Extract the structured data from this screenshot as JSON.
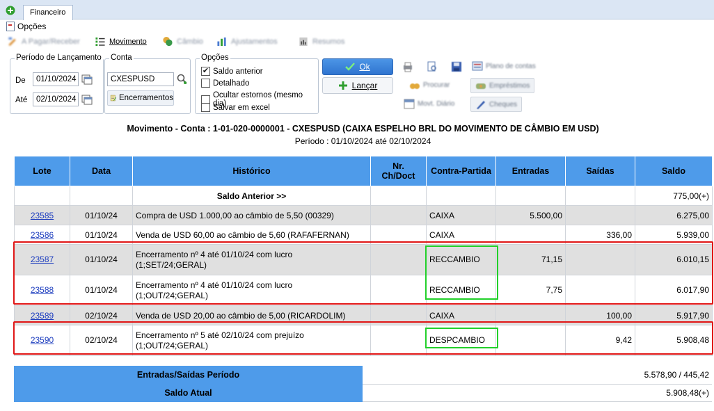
{
  "window": {
    "tab_label": "Financeiro",
    "menu_opcoes": "Opções"
  },
  "toolbar": {
    "pagar_receber": "A Pagar/Receber",
    "movimento": "Movimento",
    "cambio": "Câmbio",
    "ajustamentos": "Ajustamentos",
    "resumos": "Resumos"
  },
  "periodo": {
    "legend": "Período de Lançamento",
    "de_label": "De",
    "de_value": "01/10/2024",
    "ate_label": "Até",
    "ate_value": "02/10/2024"
  },
  "conta": {
    "legend": "Conta",
    "value": "CXESPUSD",
    "encerramentos_label": "Encerramentos"
  },
  "opcoes": {
    "legend": "Opções",
    "items": [
      {
        "label": "Saldo anterior",
        "checked": true
      },
      {
        "label": "Detalhado",
        "checked": false
      },
      {
        "label": "Ocultar estornos (mesmo dia)",
        "checked": false
      },
      {
        "label": "Salvar em excel",
        "checked": false
      }
    ]
  },
  "actions": {
    "ok_label": "Ok",
    "lancar_label": "Lançar",
    "plano_contas": "Plano de contas",
    "procurar": "Procurar",
    "emprestimos": "Empréstimos",
    "movt_diario": "Movt. Diário",
    "cheques": "Cheques"
  },
  "report": {
    "title": "Movimento - Conta : 1-01-020-0000001 - CXESPUSD (CAIXA ESPELHO BRL DO MOVIMENTO DE CÂMBIO EM USD)",
    "period": "Período : 01/10/2024 até 02/10/2024"
  },
  "table": {
    "headers": {
      "lote": "Lote",
      "data": "Data",
      "historico": "Histórico",
      "nr_line1": "Nr.",
      "nr_line2": "Ch/Doct",
      "contra": "Contra-Partida",
      "entradas": "Entradas",
      "saidas": "Saídas",
      "saldo": "Saldo"
    },
    "saldo_anterior": {
      "label": "Saldo Anterior >>",
      "saldo": "775,00(+)"
    },
    "rows": [
      {
        "lote": "23585",
        "data": "01/10/24",
        "hist1": "Compra de USD 1.000,00 ao câmbio de 5,50 (00329)",
        "hist2": "",
        "contra": "CAIXA",
        "entradas": "5.500,00",
        "saidas": "",
        "saldo": "6.275,00"
      },
      {
        "lote": "23586",
        "data": "01/10/24",
        "hist1": "Venda de USD 60,00 ao câmbio de 5,60 (RAFAFERNAN)",
        "hist2": "",
        "contra": "CAIXA",
        "entradas": "",
        "saidas": "336,00",
        "saldo": "5.939,00"
      },
      {
        "lote": "23587",
        "data": "01/10/24",
        "hist1": "Encerramento nº 4 até 01/10/24 com lucro",
        "hist2": "(1;SET/24;GERAL)",
        "contra": "RECCAMBIO",
        "entradas": "71,15",
        "saidas": "",
        "saldo": "6.010,15"
      },
      {
        "lote": "23588",
        "data": "01/10/24",
        "hist1": "Encerramento nº 4 até 01/10/24 com lucro",
        "hist2": "(1;OUT/24;GERAL)",
        "contra": "RECCAMBIO",
        "entradas": "7,75",
        "saidas": "",
        "saldo": "6.017,90"
      },
      {
        "lote": "23589",
        "data": "02/10/24",
        "hist1": "Venda de USD 20,00 ao câmbio de 5,00 (RICARDOLIM)",
        "hist2": "",
        "contra": "CAIXA",
        "entradas": "",
        "saidas": "100,00",
        "saldo": "5.917,90"
      },
      {
        "lote": "23590",
        "data": "02/10/24",
        "hist1": "Encerramento nº 5 até 02/10/24 com prejuízo",
        "hist2": "(1;OUT/24;GERAL)",
        "contra": "DESPCAMBIO",
        "entradas": "",
        "saidas": "9,42",
        "saldo": "5.908,48"
      }
    ]
  },
  "summary": {
    "periodo_label": "Entradas/Saídas Período",
    "periodo_value": "5.578,90 / 445,42",
    "saldo_label": "Saldo Atual",
    "saldo_value": "5.908,48(+)"
  },
  "colors": {
    "header_blue": "#4e9bea",
    "highlight_red": "#e01616",
    "highlight_green": "#22d02a"
  }
}
